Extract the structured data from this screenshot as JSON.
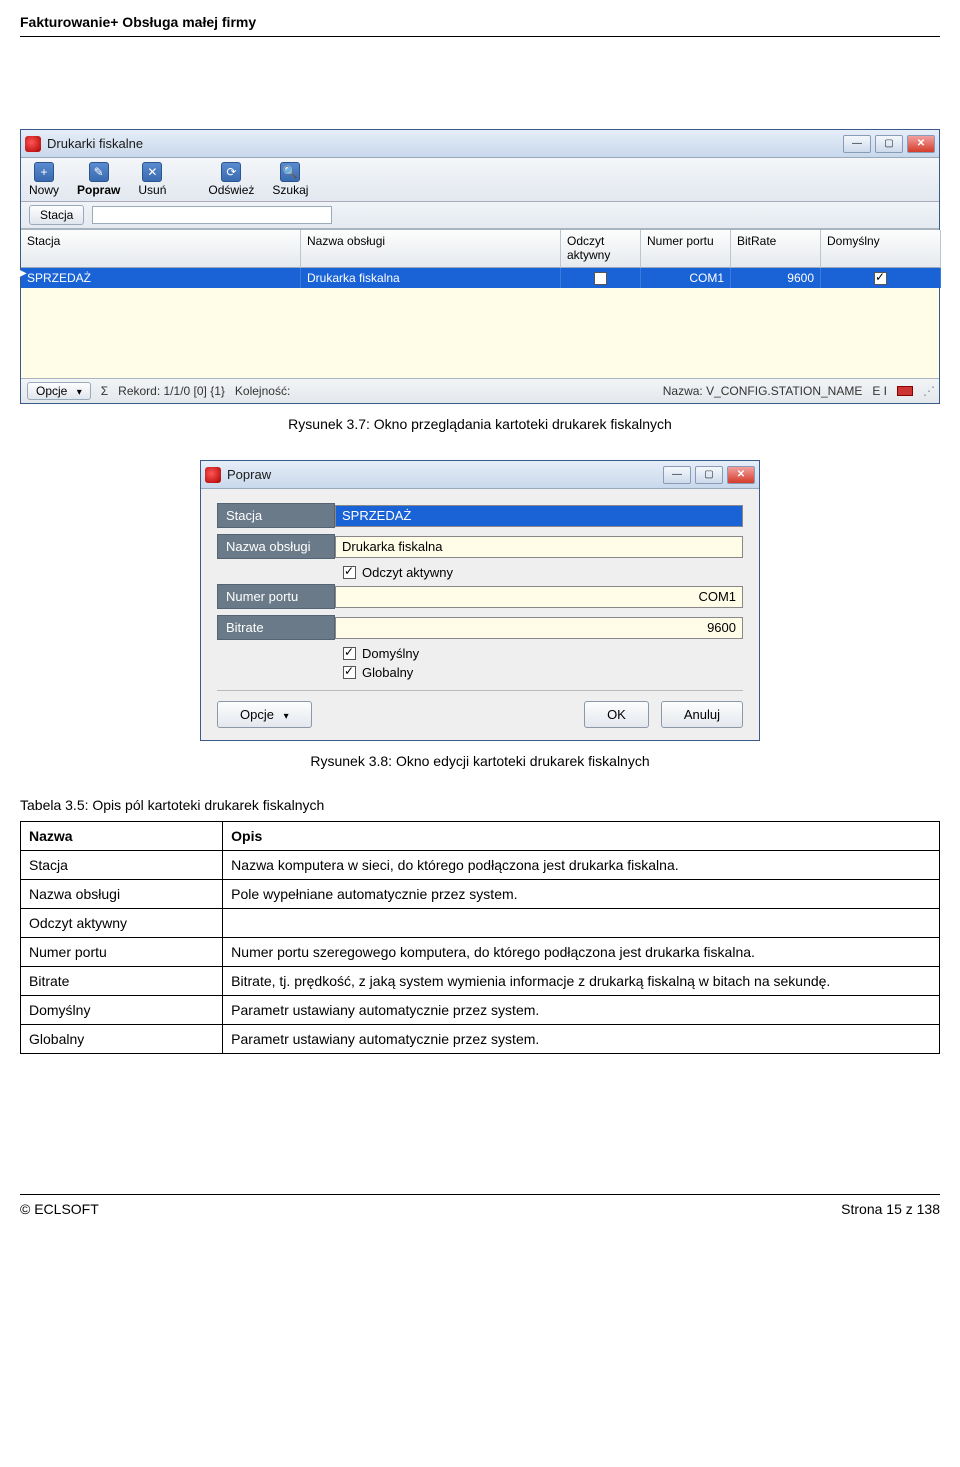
{
  "doc": {
    "header": "Fakturowanie+ Obsługa małej firmy",
    "footer_left": "© ECLSOFT",
    "footer_right": "Strona 15 z 138",
    "caption1": "Rysunek 3.7: Okno przeglądania kartoteki drukarek fiskalnych",
    "caption2": "Rysunek 3.8: Okno edycji kartoteki drukarek fiskalnych",
    "table_caption": "Tabela 3.5: Opis pól kartoteki drukarek fiskalnych"
  },
  "win1": {
    "title": "Drukarki fiskalne",
    "toolbar": {
      "nowy": "Nowy",
      "popraw": "Popraw",
      "usun": "Usuń",
      "odswiez": "Odśwież",
      "szukaj": "Szukaj"
    },
    "filter_label": "Stacja",
    "columns": {
      "c1": "Stacja",
      "c2": "Nazwa obsługi",
      "c3": "Odczyt aktywny",
      "c4": "Numer portu",
      "c5": "BitRate",
      "c6": "Domyślny"
    },
    "row": {
      "stacja": "SPRZEDAŻ",
      "nazwa": "Drukarka fiskalna",
      "port": "COM1",
      "bitrate": "9600"
    },
    "status": {
      "opcje": "Opcje",
      "sigma": "Σ",
      "rekord": "Rekord: 1/1/0  [0]  {1}",
      "kolejnosc_lbl": "Kolejność:",
      "nazwa_lbl": "Nazwa: V_CONFIG.STATION_NAME",
      "ei": "E I"
    }
  },
  "win2": {
    "title": "Popraw",
    "labels": {
      "stacja": "Stacja",
      "nazwa": "Nazwa obsługi",
      "numer": "Numer portu",
      "bitrate": "Bitrate"
    },
    "values": {
      "stacja": "SPRZEDAŻ",
      "nazwa": "Drukarka fiskalna",
      "numer": "COM1",
      "bitrate": "9600"
    },
    "checks": {
      "odczyt": "Odczyt aktywny",
      "domyslny": "Domyślny",
      "globalny": "Globalny"
    },
    "buttons": {
      "opcje": "Opcje",
      "ok": "OK",
      "anuluj": "Anuluj"
    }
  },
  "desc_table": {
    "head_name": "Nazwa",
    "head_desc": "Opis",
    "rows": [
      {
        "n": "Stacja",
        "d": "Nazwa komputera w sieci, do którego podłączona jest drukarka fiskalna."
      },
      {
        "n": "Nazwa obsługi",
        "d": "Pole wypełniane automatycznie przez system."
      },
      {
        "n": "Odczyt aktywny",
        "d": ""
      },
      {
        "n": "Numer portu",
        "d": "Numer portu szeregowego komputera, do którego podłączona jest drukarka fiskalna."
      },
      {
        "n": "Bitrate",
        "d": "Bitrate, tj. prędkość, z jaką system wymienia informacje z drukarką fiskalną w bitach na sekundę."
      },
      {
        "n": "Domyślny",
        "d": "Parametr ustawiany automatycznie przez system."
      },
      {
        "n": "Globalny",
        "d": "Parametr ustawiany automatycznie przez system."
      }
    ]
  }
}
